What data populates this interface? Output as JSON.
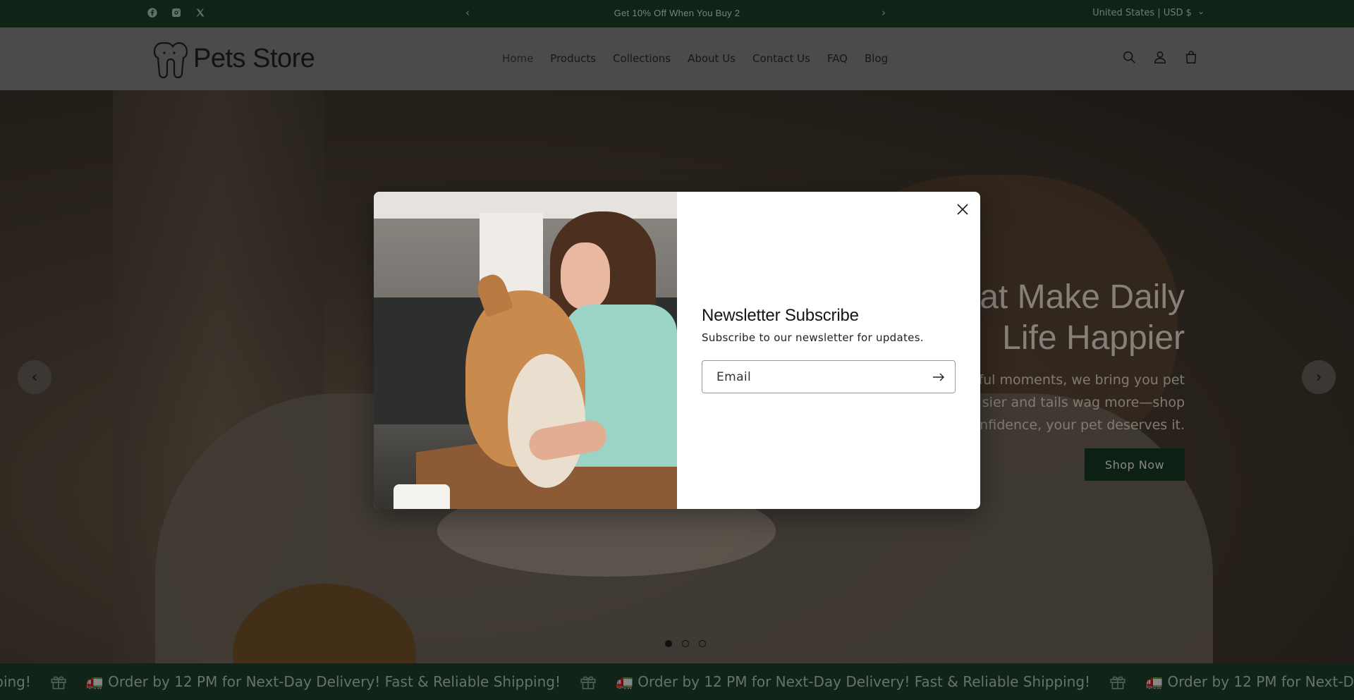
{
  "announcement": {
    "message": "Get 10% Off When You Buy 2",
    "prev_arrow": "‹",
    "next_arrow": "›",
    "region": "United States | USD $",
    "region_chevron": "⌄",
    "socials": [
      "facebook-icon",
      "instagram-icon",
      "x-icon"
    ]
  },
  "header": {
    "logo_text": "Pets Store",
    "nav": [
      "Home",
      "Products",
      "Collections",
      "About Us",
      "Contact Us",
      "FAQ",
      "Blog"
    ],
    "icons": [
      "search-icon",
      "account-icon",
      "cart-icon"
    ]
  },
  "hero": {
    "headline_line1": "s That Make Daily",
    "headline_line2": "Life Happier",
    "body_line1": "ful moments, we bring you pet",
    "body_line2": "sier and tails wag more—shop",
    "body_line3": "onfidence, your pet deserves it.",
    "cta": "Shop Now",
    "prev": "‹",
    "next": "›",
    "slides": 3,
    "active_slide": 1
  },
  "marquee": {
    "items": [
      "ipping!",
      "🚛 Order by 12 PM for Next-Day Delivery! Fast & Reliable Shipping!",
      "🚛 Order by 12 PM for Next-Day Delivery! Fast & Reliable Shipping!",
      "🚛 Order by 12 PM for Next-Day Deliv"
    ]
  },
  "modal": {
    "title": "Newsletter Subscribe",
    "subtitle": "Subscribe to our newsletter for updates.",
    "email_placeholder": "Email",
    "email_value": ""
  },
  "colors": {
    "announcement_bg": "#193a26",
    "marquee_bg": "#1a3b26",
    "cta_bg": "#153421",
    "modal_bg": "#ffffff"
  }
}
